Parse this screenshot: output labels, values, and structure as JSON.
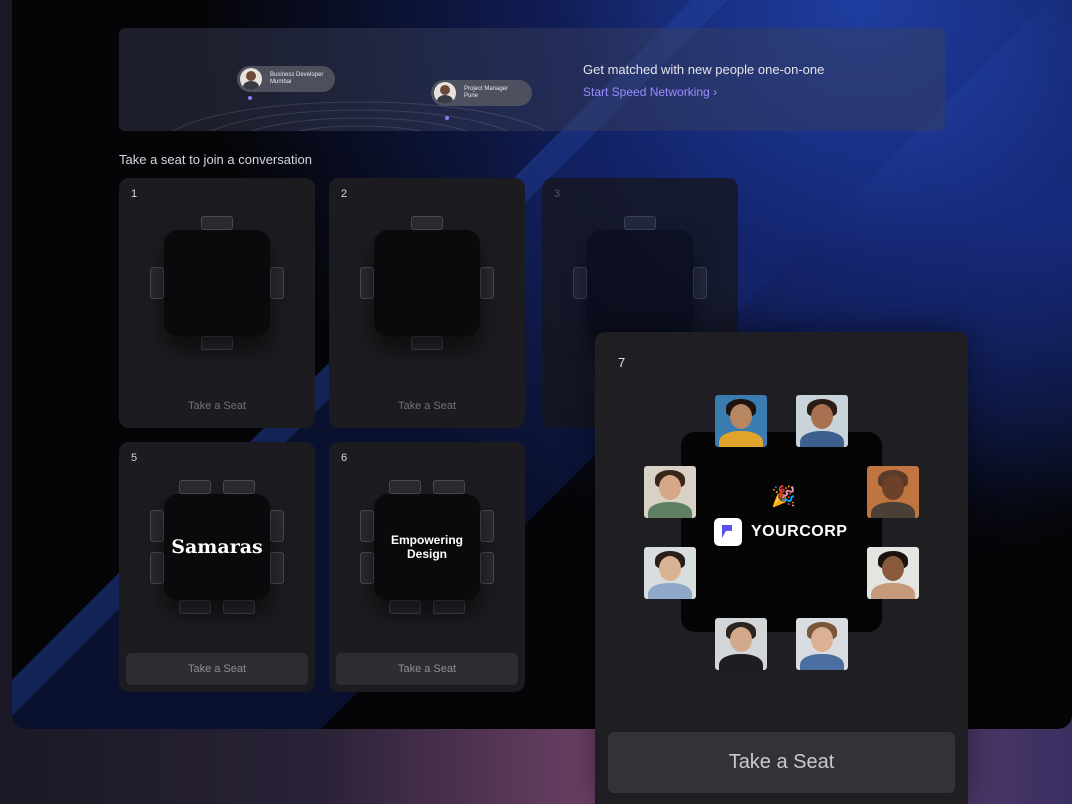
{
  "banner": {
    "profiles": [
      {
        "role": "Business Developer",
        "city": "Mumbai"
      },
      {
        "role": "Project Manager",
        "city": "Pune"
      }
    ],
    "title": "Get matched with new people one-on-one",
    "link": "Start Speed Networking ›"
  },
  "section_title": "Take a seat to join a conversation",
  "tables": [
    {
      "number": "1",
      "action": "Take a Seat",
      "label": ""
    },
    {
      "number": "2",
      "action": "Take a Seat",
      "label": ""
    },
    {
      "number": "3",
      "action": "",
      "label": ""
    },
    {
      "number": "5",
      "action": "Take a Seat",
      "label": "Samaras"
    },
    {
      "number": "6",
      "action": "Take a Seat",
      "label": "Empowering Design"
    }
  ],
  "popup": {
    "number": "7",
    "brand": "YOURCORP",
    "emoji": "🎉",
    "action": "Take a Seat"
  },
  "colors": {
    "accent": "#9b8cff",
    "brand_logo": "#5b4ff0"
  },
  "icons": {
    "link_chevron": "chevron-right-icon",
    "party": "party-popper-icon",
    "brand_logo": "yourcorp-logo-icon"
  }
}
